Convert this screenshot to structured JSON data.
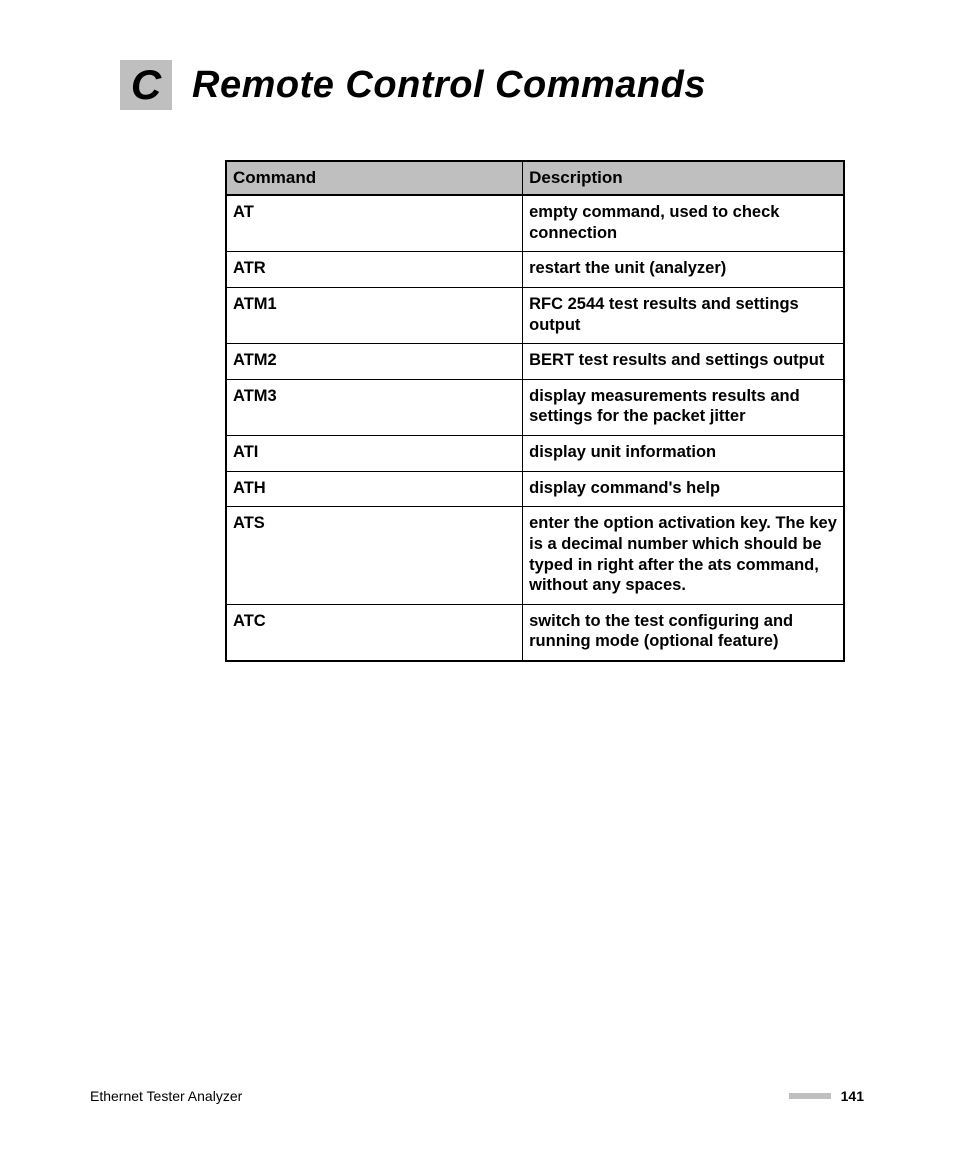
{
  "heading": {
    "letter": "C",
    "title": "Remote Control Commands"
  },
  "table": {
    "headers": {
      "command": "Command",
      "description": "Description"
    },
    "rows": [
      {
        "command": "AT",
        "description": "empty command, used to check connection"
      },
      {
        "command": "ATR",
        "description": "restart the unit (analyzer)"
      },
      {
        "command": "ATM1",
        "description": "RFC 2544 test results and settings output"
      },
      {
        "command": "ATM2",
        "description": "BERT test results and settings output"
      },
      {
        "command": "ATM3",
        "description": "display measurements results and settings for the packet jitter"
      },
      {
        "command": "ATI",
        "description": "display unit information"
      },
      {
        "command": "ATH",
        "description": "display command's help"
      },
      {
        "command": "ATS",
        "description": "enter the option activation key. The key is a decimal number which should be typed in right after the ats command, without any spaces."
      },
      {
        "command": "ATC",
        "description": "switch to the test configuring and running mode (optional feature)"
      }
    ]
  },
  "footer": {
    "product": "Ethernet Tester Analyzer",
    "page": "141"
  }
}
